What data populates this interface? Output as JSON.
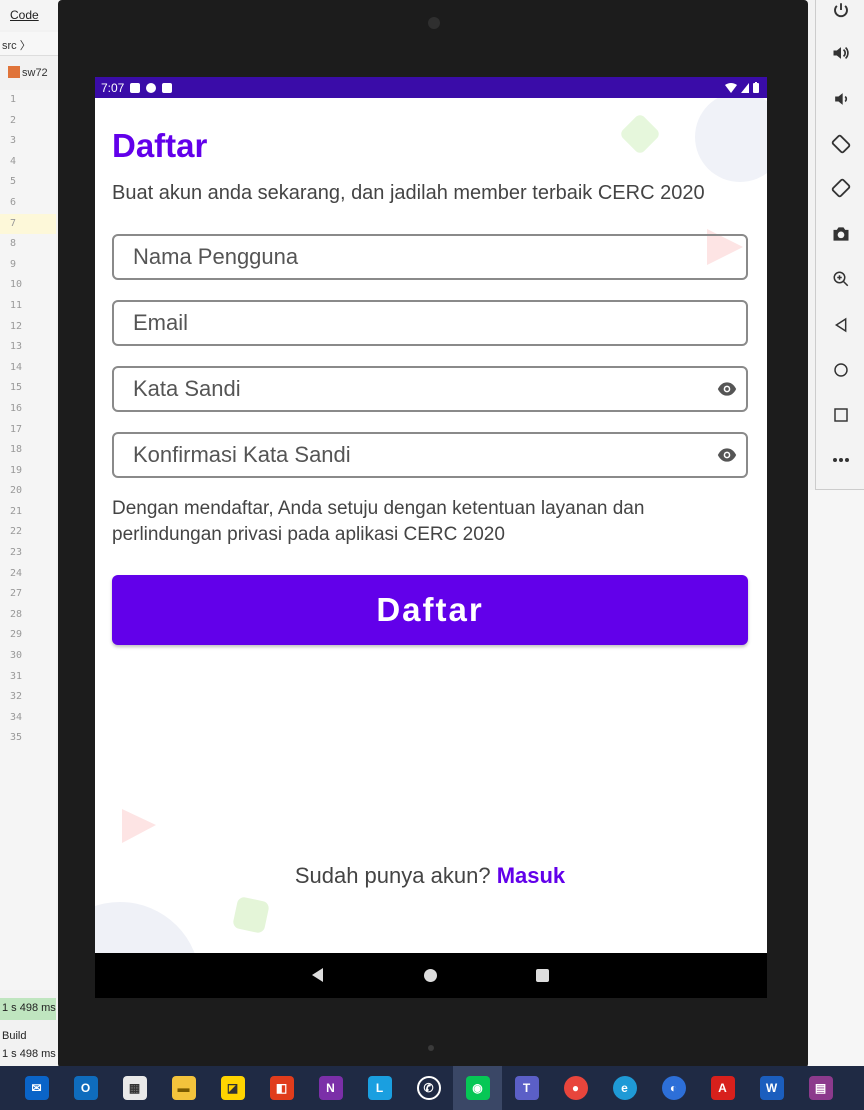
{
  "ide": {
    "menu_code": "Code",
    "breadcrumb": "src 〉",
    "file_tab": "sw72",
    "line_numbers": [
      "1",
      "2",
      "3",
      "4",
      "5",
      "6",
      "7",
      "8",
      "9",
      "10",
      "11",
      "12",
      "13",
      "14",
      "15",
      "16",
      "17",
      "18",
      "19",
      "20",
      "21",
      "22",
      "23",
      "24",
      "27",
      "28",
      "29",
      "30",
      "31",
      "32",
      "34",
      "35"
    ],
    "status_time": "1 s 498 ms",
    "build_label": "Build",
    "build_time": "1 s 498 ms"
  },
  "emulator_tools": [
    "power-icon",
    "volume-up-icon",
    "volume-down-icon",
    "rotate-left-icon",
    "rotate-right-icon",
    "camera-icon",
    "zoom-icon",
    "back-icon",
    "home-icon",
    "overview-icon",
    "more-icon"
  ],
  "statusbar": {
    "time": "7:07"
  },
  "screen": {
    "title": "Daftar",
    "subtitle": "Buat akun anda sekarang, dan jadilah member terbaik CERC 2020",
    "fields": {
      "username_placeholder": "Nama Pengguna",
      "email_placeholder": "Email",
      "password_placeholder": "Kata Sandi",
      "confirm_placeholder": "Konfirmasi Kata Sandi"
    },
    "terms": "Dengan mendaftar, Anda setuju dengan ketentuan layanan dan perlindungan privasi pada aplikasi CERC 2020",
    "submit_label": "Daftar",
    "footer_text": "Sudah punya akun?",
    "footer_link": "Masuk"
  },
  "colors": {
    "accent": "#6200ea",
    "statusbar": "#3a0ca8"
  },
  "taskbar": [
    "mail-icon",
    "outlook-icon",
    "store-icon",
    "file-explorer-icon",
    "sticky-notes-icon",
    "office-icon",
    "onenote-icon",
    "line-desktop-icon",
    "whatsapp-icon",
    "line-icon",
    "teams-icon",
    "chrome-icon",
    "edge-icon",
    "globe-icon",
    "acrobat-icon",
    "word-icon",
    "winrar-icon",
    "app-icon"
  ]
}
